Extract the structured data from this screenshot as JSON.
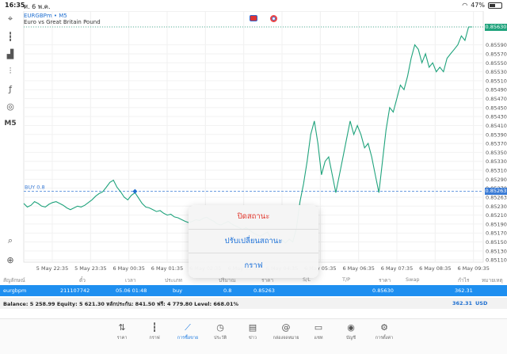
{
  "status_bar": {
    "time": "16:35",
    "date": "ศ. 6 พ.ค.",
    "battery": "47%",
    "battery_level": 0.47
  },
  "toolbar": {
    "items": [
      {
        "name": "crosshair-icon",
        "glyph": "⌖"
      },
      {
        "name": "candles-icon",
        "glyph": "┇"
      },
      {
        "name": "indicators-icon",
        "glyph": "▟"
      },
      {
        "name": "objects-icon",
        "glyph": "⫶"
      },
      {
        "name": "function-icon",
        "glyph": "ƒ"
      },
      {
        "name": "shapes-icon",
        "glyph": "◎"
      },
      {
        "name": "timeframe-label",
        "text": "M5"
      },
      {
        "name": "search-icon",
        "glyph": "⌕"
      },
      {
        "name": "trade-icon",
        "glyph": "⊕"
      }
    ]
  },
  "symbol": {
    "name": "EURGBPm • M5",
    "description": "Euro vs Great Britain Pound"
  },
  "chart_data": {
    "type": "line",
    "x_labels": [
      "5 May 22:35",
      "5 May 23:35",
      "6 May 00:35",
      "6 May 01:35",
      "6 May 02:35",
      "6 May 03:35",
      "6 May 04:35",
      "6 May 05:35",
      "6 May 06:35",
      "6 May 07:35",
      "6 May 08:35",
      "6 May 09:35"
    ],
    "y_ticks": [
      0.8563,
      0.8559,
      0.8557,
      0.8555,
      0.8553,
      0.8551,
      0.8549,
      0.8547,
      0.8545,
      0.8543,
      0.8541,
      0.8539,
      0.8537,
      0.8535,
      0.8533,
      0.8531,
      0.8529,
      0.8527,
      0.8525,
      0.8523,
      0.8521,
      0.8519,
      0.8517,
      0.8515,
      0.8513,
      0.8511
    ],
    "y_tick_labels": [
      "0.85630",
      "0.85590",
      "0.85570",
      "0.85550",
      "0.85530",
      "0.85510",
      "0.85490",
      "0.85470",
      "0.85450",
      "0.85430",
      "0.85410",
      "0.85390",
      "0.85370",
      "0.85350",
      "0.85330",
      "0.85310",
      "0.85290",
      "0.85270",
      "0.85263",
      "0.85230",
      "0.85210",
      "0.85190",
      "0.85170",
      "0.85150",
      "0.85130",
      "0.85110"
    ],
    "ylim": [
      0.85105,
      0.8563
    ],
    "series": [
      {
        "values": [
          0.85236,
          0.85228,
          0.85232,
          0.8524,
          0.85236,
          0.8523,
          0.85228,
          0.85234,
          0.85238,
          0.8524,
          0.85236,
          0.85232,
          0.85226,
          0.85222,
          0.85226,
          0.8523,
          0.85228,
          0.85232,
          0.85238,
          0.85244,
          0.85252,
          0.85258,
          0.85262,
          0.85272,
          0.85283,
          0.85288,
          0.85272,
          0.85262,
          0.8525,
          0.85244,
          0.85254,
          0.8526,
          0.85248,
          0.85236,
          0.85228,
          0.85226,
          0.85222,
          0.85218,
          0.8522,
          0.85214,
          0.8521,
          0.85212,
          0.85206,
          0.85204,
          0.852,
          0.85196,
          0.85193,
          0.85196,
          0.852,
          0.85198,
          0.85203,
          0.85205,
          0.852,
          0.85196,
          0.8519,
          0.85188,
          0.85192,
          0.85196,
          0.8519,
          0.85186,
          0.85182,
          0.85178,
          0.85182,
          0.85176,
          0.8517,
          0.85166,
          0.85163,
          0.85168,
          0.85172,
          0.85156,
          0.8515,
          0.85146,
          0.85154,
          0.85148,
          0.85156,
          0.8515,
          0.8518,
          0.8524,
          0.8528,
          0.8533,
          0.8539,
          0.8542,
          0.8537,
          0.853,
          0.8533,
          0.8534,
          0.853,
          0.8526,
          0.853,
          0.8534,
          0.8538,
          0.8542,
          0.8539,
          0.8541,
          0.8539,
          0.8536,
          0.8537,
          0.8534,
          0.853,
          0.8526,
          0.8533,
          0.854,
          0.8545,
          0.8544,
          0.8547,
          0.855,
          0.8549,
          0.8552,
          0.8556,
          0.8559,
          0.8558,
          0.8555,
          0.8557,
          0.8554,
          0.8555,
          0.8553,
          0.8554,
          0.8553,
          0.8556,
          0.8557,
          0.8558,
          0.8559,
          0.8561,
          0.856,
          0.8563,
          0.8563
        ]
      }
    ],
    "line_color": "#1fa37c",
    "grid": true,
    "reference_lines": [
      {
        "label": "BUY 0.8",
        "value": 0.85263,
        "color": "#3a7bd5",
        "style": "dashed"
      },
      {
        "value": 0.8563,
        "color": "#1fa37c",
        "style": "dotted"
      }
    ],
    "trade_marker": {
      "value": 0.85263,
      "color": "#1e6fd0"
    },
    "current_price_label": "0.85630",
    "buy_price_label": "0.85263"
  },
  "context_menu": {
    "items": [
      {
        "label": "ปิดสถานะ",
        "kind": "danger"
      },
      {
        "label": "ปรับเปลี่ยนสถานะ",
        "kind": "normal"
      },
      {
        "label": "กราฟ",
        "kind": "normal"
      }
    ]
  },
  "trades": {
    "headers": [
      "สัญลักษณ์",
      "ตั๋ว",
      "เวลา",
      "ประเภท",
      "ปริมาณ",
      "ราคา",
      "S/L",
      "T/P",
      "ราคา",
      "Swap",
      "กำไร",
      "หมายเหตุ"
    ],
    "row": {
      "symbol": "eurgbpm",
      "ticket": "211107742",
      "time": "05.06 01:48",
      "type": "buy",
      "volume": "0.8",
      "open_price": "0.85263",
      "current_price": "0.85630",
      "profit": "362.31"
    }
  },
  "balance": {
    "text": "Balance: 5 258.99 Equity: 5 621.30 หลักประกัน: 841.50 ฟรี: 4 779.80 Level: 668.01%",
    "profit": "362.31",
    "currency": "USD"
  },
  "tabs": [
    {
      "label": "ราคา",
      "icon": "quotes-icon",
      "glyph": "⇅"
    },
    {
      "label": "กราฟ",
      "icon": "chart-icon",
      "glyph": "┇"
    },
    {
      "label": "การซื้อขาย",
      "icon": "trade-icon",
      "glyph": "⟋",
      "active": true
    },
    {
      "label": "ประวัติ",
      "icon": "history-icon",
      "glyph": "◷"
    },
    {
      "label": "ข่าว",
      "icon": "news-icon",
      "glyph": "▤"
    },
    {
      "label": "กล่องจดหมาย",
      "icon": "mailbox-icon",
      "glyph": "@"
    },
    {
      "label": "แชท",
      "icon": "chat-icon",
      "glyph": "▭"
    },
    {
      "label": "บัญชี",
      "icon": "account-icon",
      "glyph": "◉"
    },
    {
      "label": "การตั้งค่า",
      "icon": "settings-icon",
      "glyph": "⚙"
    }
  ]
}
